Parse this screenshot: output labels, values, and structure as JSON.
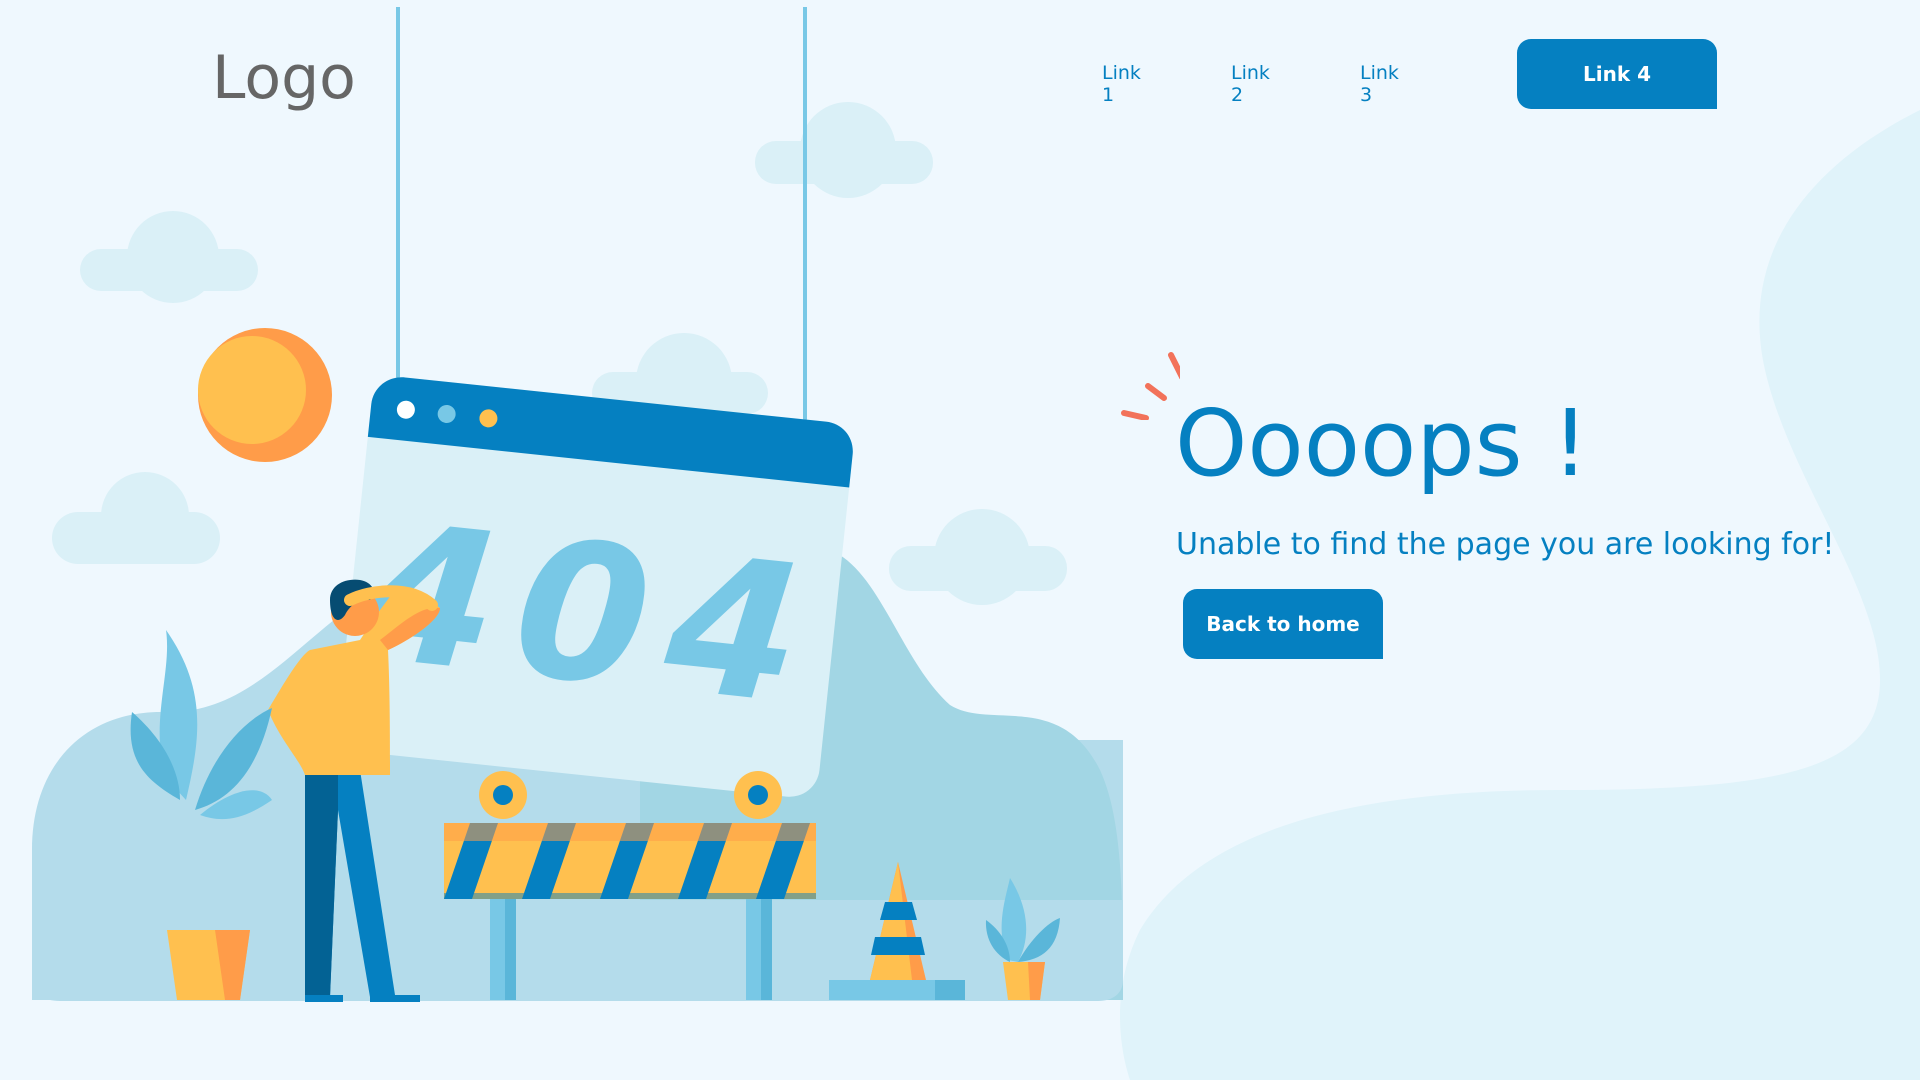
{
  "header": {
    "logo_text": "Logo",
    "nav_links": [
      "Link 1",
      "Link 2",
      "Link 3"
    ],
    "cta_label": "Link 4"
  },
  "illustration": {
    "error_code": "404"
  },
  "message": {
    "headline": "Oooops !",
    "subline": "Unable to find the page you are looking for!",
    "home_button_label": "Back to home"
  },
  "colors": {
    "background": "#eff8fe",
    "primary": "#0580c1",
    "logo_text": "#666666",
    "sun": "#ffc04f",
    "accent_orange": "#ff9c49",
    "burst": "#f2725a",
    "hill": "#b4dceb",
    "cloud": "#daf0f7"
  }
}
